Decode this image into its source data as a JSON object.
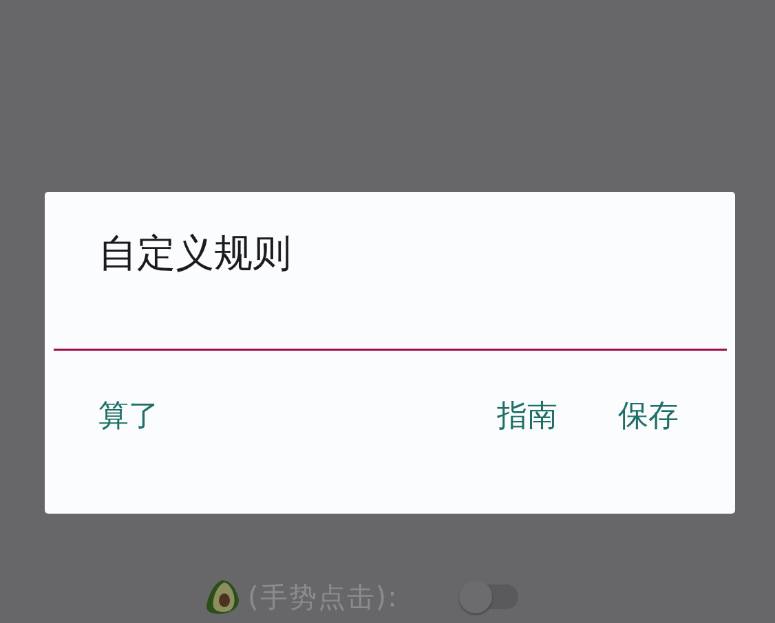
{
  "dialog": {
    "title": "自定义规则",
    "input": {
      "focused": true
    },
    "left_buttons": [
      {
        "label": "算了"
      }
    ],
    "right_buttons": [
      {
        "label": "指南"
      },
      {
        "label": "保存"
      }
    ]
  },
  "background_setting": {
    "label": "(手势点击):",
    "on": false
  }
}
